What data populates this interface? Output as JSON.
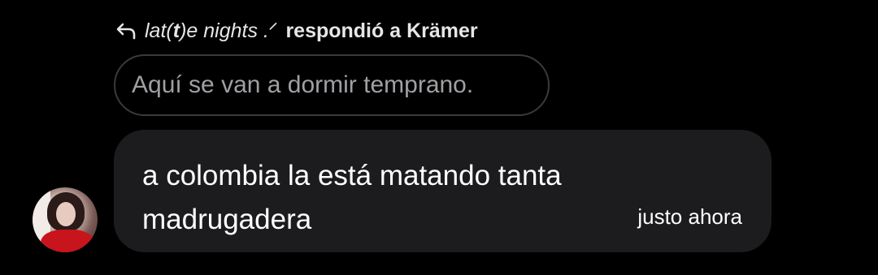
{
  "reply": {
    "replier_name_prefix": "lat(",
    "replier_name_bold": "t",
    "replier_name_suffix": ")e nights .ᐟ",
    "action": "respondió a Krämer",
    "quoted_text": "Aquí se van a dormir temprano."
  },
  "message": {
    "text": "a colombia la está matando tanta madrugadera",
    "timestamp": "justo ahora"
  },
  "icons": {
    "reply": "reply-arrow-icon",
    "avatar": "user-avatar"
  },
  "colors": {
    "background": "#000000",
    "bubble": "#1c1c1e",
    "quote_border": "#3a3a3c",
    "quote_text": "#a0a0a4",
    "text": "#ffffff"
  }
}
